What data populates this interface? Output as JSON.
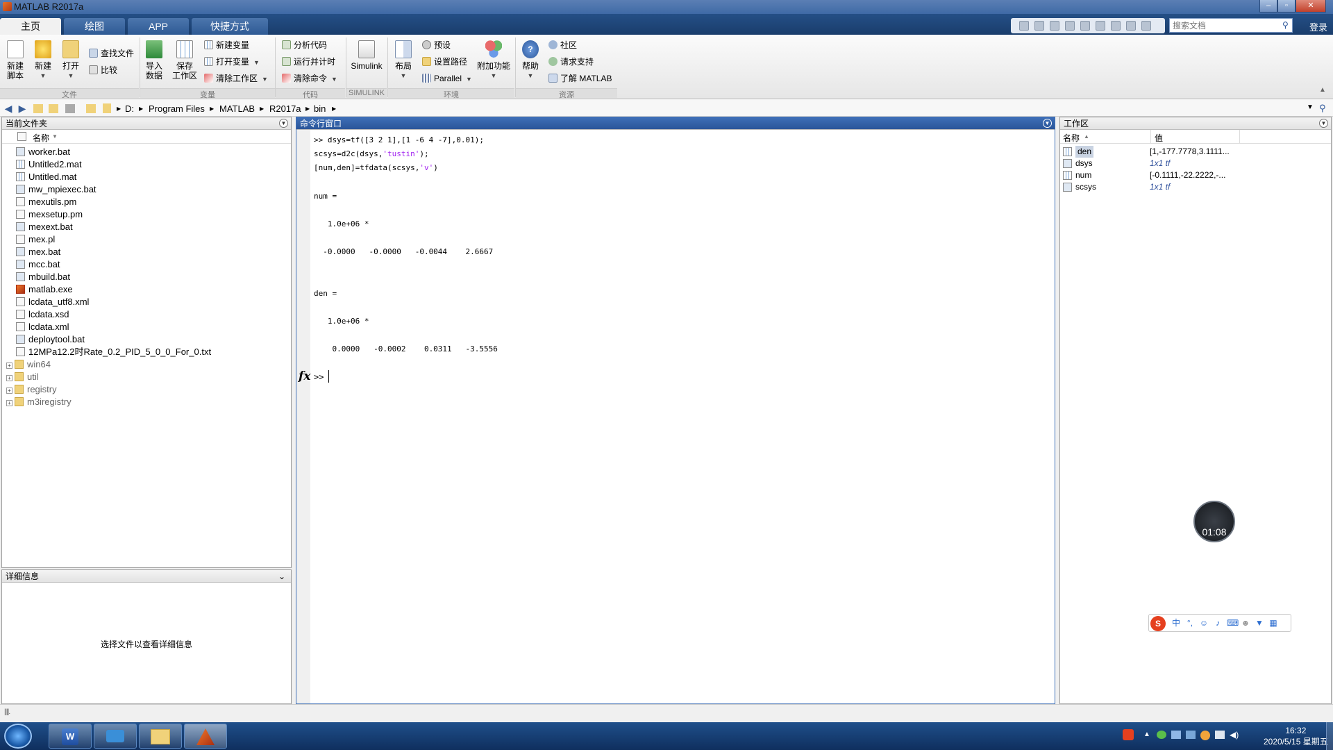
{
  "window": {
    "title": "MATLAB R2017a"
  },
  "tabs": [
    "主页",
    "绘图",
    "APP",
    "快捷方式"
  ],
  "search": {
    "placeholder": "搜索文档"
  },
  "login_label": "登录",
  "ribbon": {
    "new_script": "新建\n脚本",
    "new": "新建",
    "open": "打开",
    "find_files": "查找文件",
    "compare": "比较",
    "import_data": "导入\n数据",
    "save_workspace": "保存\n工作区",
    "new_variable": "新建变量",
    "open_variable": "打开变量",
    "clear_workspace": "清除工作区",
    "analyze_code": "分析代码",
    "run_and_time": "运行并计时",
    "clear_commands": "清除命令",
    "simulink": "Simulink",
    "layout": "布局",
    "preferences": "预设",
    "set_path": "设置路径",
    "parallel": "Parallel",
    "addons": "附加功能",
    "help": "帮助",
    "community": "社区",
    "request_support": "请求支持",
    "learn_matlab": "了解 MATLAB",
    "groups": [
      "文件",
      "变量",
      "代码",
      "SIMULINK",
      "环境",
      "资源"
    ]
  },
  "address": {
    "crumbs": [
      "D:",
      "Program Files",
      "MATLAB",
      "R2017a",
      "bin"
    ]
  },
  "current_folder": {
    "title": "当前文件夹",
    "column": "名称",
    "files": [
      {
        "name": "worker.bat",
        "icon": "bat"
      },
      {
        "name": "Untitled2.mat",
        "icon": "mat"
      },
      {
        "name": "Untitled.mat",
        "icon": "mat"
      },
      {
        "name": "mw_mpiexec.bat",
        "icon": "bat"
      },
      {
        "name": "mexutils.pm",
        "icon": "file"
      },
      {
        "name": "mexsetup.pm",
        "icon": "file"
      },
      {
        "name": "mexext.bat",
        "icon": "bat"
      },
      {
        "name": "mex.pl",
        "icon": "file"
      },
      {
        "name": "mex.bat",
        "icon": "bat"
      },
      {
        "name": "mcc.bat",
        "icon": "bat"
      },
      {
        "name": "mbuild.bat",
        "icon": "bat"
      },
      {
        "name": "matlab.exe",
        "icon": "exe"
      },
      {
        "name": "lcdata_utf8.xml",
        "icon": "file"
      },
      {
        "name": "lcdata.xsd",
        "icon": "file"
      },
      {
        "name": "lcdata.xml",
        "icon": "file"
      },
      {
        "name": "deploytool.bat",
        "icon": "bat"
      },
      {
        "name": "12MPa12.2时Rate_0.2_PID_5_0_0_For_0.txt",
        "icon": "file"
      }
    ],
    "folders": [
      "win64",
      "util",
      "registry",
      "m3iregistry"
    ]
  },
  "details": {
    "title": "详细信息",
    "message": "选择文件以查看详细信息"
  },
  "command_window": {
    "title": "命令行窗口",
    "line1_a": ">> dsys=tf([3 2 1],[1 -6 4 -7],0.01);",
    "line2_a": "scsys=d2c(dsys,",
    "line2_str": "'tustin'",
    "line2_b": ");",
    "line3_a": "[num,den]=tfdata(scsys,",
    "line3_str": "'v'",
    "line3_b": ")",
    "num_label": "num =",
    "num_scale": "   1.0e+06 *",
    "num_values": "  -0.0000   -0.0000   -0.0044    2.6667",
    "den_label": "den =",
    "den_scale": "   1.0e+06 *",
    "den_values": "    0.0000   -0.0002    0.0311   -3.5556",
    "prompt": ">>",
    "fx": "fx"
  },
  "workspace": {
    "title": "工作区",
    "col_name": "名称",
    "col_value": "值",
    "vars": [
      {
        "name": "den",
        "value": "[1,-177.7778,3.1111...",
        "italic": false
      },
      {
        "name": "dsys",
        "value": "1x1 tf",
        "italic": true
      },
      {
        "name": "num",
        "value": "[-0.1111,-22.2222,-...",
        "italic": false
      },
      {
        "name": "scsys",
        "value": "1x1 tf",
        "italic": true
      }
    ]
  },
  "timer": "01:08",
  "ime": {
    "label": "中"
  },
  "clock": {
    "time": "16:32",
    "date": "2020/5/15 星期五"
  }
}
